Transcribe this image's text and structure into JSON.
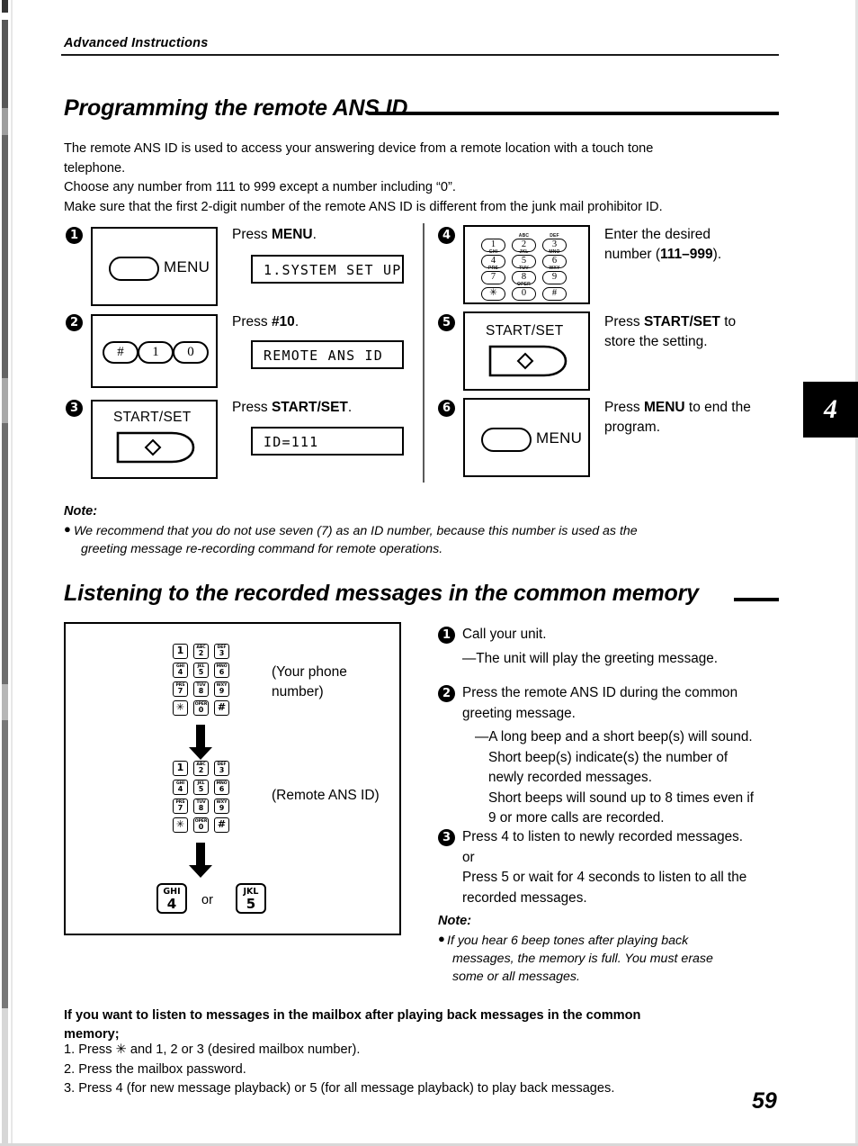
{
  "page": {
    "running_head": "Advanced Instructions",
    "page_number": "59",
    "chapter_tab": "4"
  },
  "section1": {
    "heading": "Programming the remote ANS ID",
    "intro_lines": [
      "The remote ANS ID is used to access your answering device from a remote location with a touch tone",
      "telephone.",
      "Choose any number from 111 to 999 except a number including “0”.",
      "Make sure that the first 2-digit number of the remote ANS ID is different from the junk mail prohibitor ID."
    ],
    "steps": [
      {
        "num": "1",
        "panel_kind": "menu-button",
        "button_label": "MENU",
        "instruction_pre": "Press ",
        "instruction_bold": "MENU",
        "instruction_post": ".",
        "lcd": "1.SYSTEM SET UP"
      },
      {
        "num": "2",
        "panel_kind": "three-keys",
        "keys": [
          "#",
          "1",
          "0"
        ],
        "instruction_pre": "Press ",
        "instruction_bold": "#10",
        "instruction_post": ".",
        "lcd": "REMOTE ANS ID"
      },
      {
        "num": "3",
        "panel_kind": "start-set",
        "button_label": "START/SET",
        "instruction_pre": "Press ",
        "instruction_bold": "START/SET",
        "instruction_post": ".",
        "lcd": "ID=111"
      },
      {
        "num": "4",
        "panel_kind": "keypad",
        "instruction_line1": "Enter the desired",
        "instruction_line2_pre": "number (",
        "instruction_line2_bold": "111–999",
        "instruction_line2_post": ")."
      },
      {
        "num": "5",
        "panel_kind": "start-set",
        "button_label": "START/SET",
        "instruction_line1_pre": "Press ",
        "instruction_line1_bold": "START/SET",
        "instruction_line1_post": " to",
        "instruction_line2": "store the setting."
      },
      {
        "num": "6",
        "panel_kind": "menu-button",
        "button_label": "MENU",
        "instruction_line1_pre": "Press ",
        "instruction_line1_bold": "MENU",
        "instruction_line1_post": " to end the",
        "instruction_line2": "program."
      }
    ],
    "note": {
      "title": "Note:",
      "bullet": "●",
      "lines": [
        "We recommend that you do not use seven (7) as an ID number, because this number is used as the",
        "greeting message re-recording command for remote operations."
      ]
    }
  },
  "section2": {
    "heading": "Listening to the recorded messages in the common memory",
    "diagram": {
      "caption1": "(Your phone\nnumber)",
      "caption2": "(Remote ANS ID)",
      "or_label": "or",
      "keypad_keys": [
        {
          "letters": "",
          "digit": "1"
        },
        {
          "letters": "ABC",
          "digit": "2"
        },
        {
          "letters": "DEF",
          "digit": "3"
        },
        {
          "letters": "GHI",
          "digit": "4"
        },
        {
          "letters": "JKL",
          "digit": "5"
        },
        {
          "letters": "MNO",
          "digit": "6"
        },
        {
          "letters": "PRS",
          "digit": "7"
        },
        {
          "letters": "TUV",
          "digit": "8"
        },
        {
          "letters": "WXY",
          "digit": "9"
        },
        {
          "letters": "",
          "digit": "✳"
        },
        {
          "letters": "OPER",
          "digit": "0"
        },
        {
          "letters": "",
          "digit": "#"
        }
      ],
      "final_keys": [
        {
          "letters": "GHI",
          "digit": "4"
        },
        {
          "letters": "JKL",
          "digit": "5"
        }
      ]
    },
    "steps": [
      {
        "num": "1",
        "lines": [
          {
            "text": "Call your unit.",
            "indent": 0
          },
          {
            "text": "—The unit will play the greeting message.",
            "indent": 0
          }
        ]
      },
      {
        "num": "2",
        "lines": [
          {
            "text": "Press the remote ANS ID during the common",
            "indent": 0
          },
          {
            "text": "greeting message.",
            "indent": 0
          },
          {
            "text": "—A long beep and a short beep(s) will sound.",
            "indent": 1
          },
          {
            "text": "Short beep(s) indicate(s) the number of",
            "indent": 2
          },
          {
            "text": "newly recorded messages.",
            "indent": 2
          },
          {
            "text": "Short beeps will sound up to 8 times even if",
            "indent": 2
          },
          {
            "text": "9 or more calls are recorded.",
            "indent": 2
          }
        ]
      },
      {
        "num": "3",
        "lines": [
          {
            "text": "Press 4 to listen to newly recorded messages.",
            "indent": 0
          },
          {
            "text": "or",
            "indent": 0
          },
          {
            "text": "Press 5 or wait for 4 seconds to listen to all the",
            "indent": 0
          },
          {
            "text": "recorded messages.",
            "indent": 0
          }
        ]
      }
    ],
    "note": {
      "title": "Note:",
      "bullet": "●",
      "lines": [
        "If you hear 6 beep tones after playing back",
        "messages, the memory is full. You must erase",
        "some or all messages."
      ]
    }
  },
  "section3": {
    "lead_line1": "If you want to listen to messages in the mailbox after playing back messages in the common",
    "lead_line2": "memory;",
    "items": [
      "1.  Press ✳ and 1, 2 or 3 (desired mailbox number).",
      "2.  Press the mailbox password.",
      "3.  Press 4 (for new message playback) or 5 (for all message playback) to play back messages."
    ]
  }
}
